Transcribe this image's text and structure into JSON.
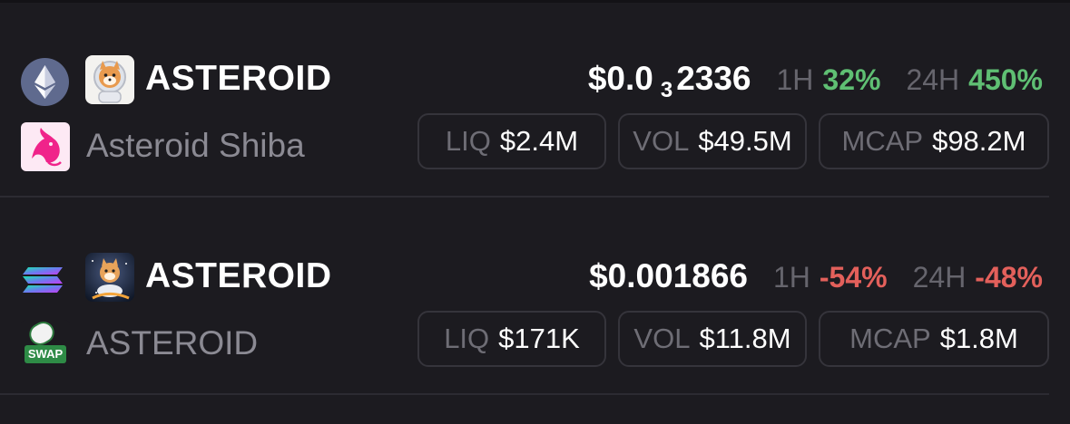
{
  "colors": {
    "background": "#1c1b20",
    "positive": "#5fbf73",
    "negative": "#e3605b",
    "muted": "#8b8a93",
    "border": "#35343b"
  },
  "rows": [
    {
      "chain_icon": "ethereum-icon",
      "dex_icon": "uniswap-icon",
      "token_icon": "shiba-astronaut-icon",
      "symbol": "ASTEROID",
      "name": "Asteroid Shiba",
      "price_prefix": "$0.0",
      "price_zeros": "3",
      "price_digits": "2336",
      "h1_label": "1H",
      "h1_value": "32%",
      "h24_label": "24H",
      "h24_value": "450%",
      "liq_label": "LIQ",
      "liq_value": "$2.4M",
      "vol_label": "VOL",
      "vol_value": "$49.5M",
      "mcap_label": "MCAP",
      "mcap_value": "$98.2M"
    },
    {
      "chain_icon": "solana-icon",
      "dex_icon": "swap-icon",
      "dex_icon_text": "SWAP",
      "token_icon": "shiba-space-icon",
      "symbol": "ASTEROID",
      "name": "ASTEROID",
      "price": "$0.001866",
      "h1_label": "1H",
      "h1_value": "-54%",
      "h24_label": "24H",
      "h24_value": "-48%",
      "liq_label": "LIQ",
      "liq_value": "$171K",
      "vol_label": "VOL",
      "vol_value": "$11.8M",
      "mcap_label": "MCAP",
      "mcap_value": "$1.8M"
    }
  ]
}
